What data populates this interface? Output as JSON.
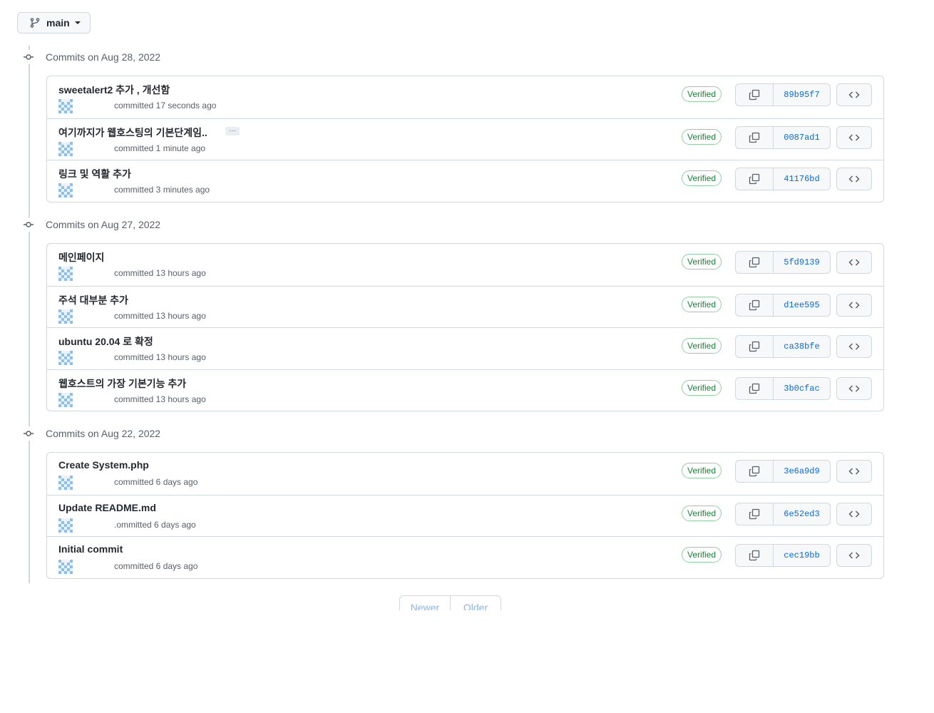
{
  "branch": {
    "label": "main"
  },
  "groups": [
    {
      "title": "Commits on Aug 28, 2022",
      "commits": [
        {
          "message": "sweetalert2 추가 , 개선함",
          "meta": "committed 17 seconds ago",
          "verified": "Verified",
          "sha": "89b95f7"
        },
        {
          "message": "여기까지가 웹호스팅의 기본단계임..",
          "meta": "committed 1 minute ago",
          "verified": "Verified",
          "sha": "0087ad1",
          "ellipsis": "…"
        },
        {
          "message": "링크 및 역활 추가",
          "meta": "committed 3 minutes ago",
          "verified": "Verified",
          "sha": "41176bd"
        }
      ]
    },
    {
      "title": "Commits on Aug 27, 2022",
      "commits": [
        {
          "message": "메인페이지",
          "meta": "committed 13 hours ago",
          "verified": "Verified",
          "sha": "5fd9139"
        },
        {
          "message": "주석 대부분 추가",
          "meta": "committed 13 hours ago",
          "verified": "Verified",
          "sha": "d1ee595"
        },
        {
          "message": "ubuntu 20.04 로 확정",
          "meta": "committed 13 hours ago",
          "verified": "Verified",
          "sha": "ca38bfe"
        },
        {
          "message": "웹호스트의 가장 기본기능 추가",
          "meta": "committed 13 hours ago",
          "verified": "Verified",
          "sha": "3b0cfac"
        }
      ]
    },
    {
      "title": "Commits on Aug 22, 2022",
      "commits": [
        {
          "message": "Create System.php",
          "meta": "committed 6 days ago",
          "verified": "Verified",
          "sha": "3e6a9d9"
        },
        {
          "message": "Update README.md",
          "meta": ".ommitted 6 days ago",
          "verified": "Verified",
          "sha": "6e52ed3"
        },
        {
          "message": "Initial commit",
          "meta": "committed 6 days ago",
          "verified": "Verified",
          "sha": "cec19bb"
        }
      ]
    }
  ],
  "pagination": {
    "newer": "Newer",
    "older": "Older"
  },
  "colors": {
    "accent": "#0969da",
    "verified": "#1a7f37",
    "border": "#d0d7de",
    "muted": "#57606a"
  },
  "icons": {
    "branch": "git-branch-icon",
    "commit_node": "git-commit-icon",
    "copy": "copy-icon",
    "browse": "code-icon",
    "avatar": "identicon-avatar"
  }
}
